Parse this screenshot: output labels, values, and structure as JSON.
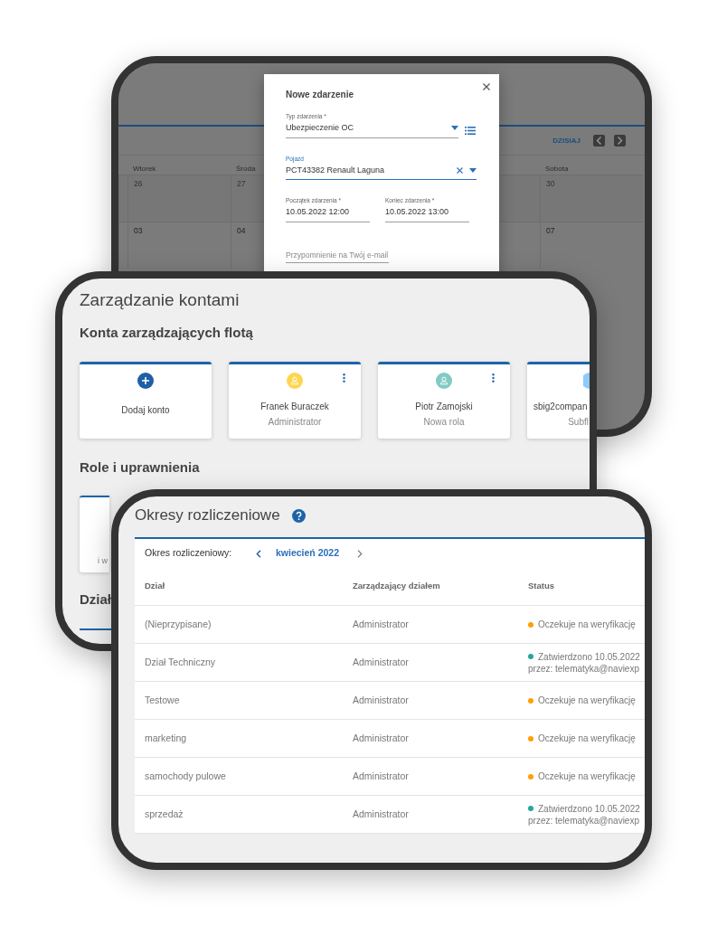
{
  "calendar_window": {
    "today_button": "DZISIAJ",
    "weekdays": [
      "Wtorek",
      "Środa",
      "Sobota"
    ],
    "weeks": [
      [
        "26",
        "27",
        "30"
      ],
      [
        "03",
        "04",
        "07"
      ]
    ],
    "dialog": {
      "title": "Nowe zdarzenie",
      "fields": [
        {
          "kind": "select",
          "label": "Typ zdarzenia *",
          "value": "Ubezpieczenie OC",
          "focused": false
        },
        {
          "kind": "clearable",
          "label": "Pojazd",
          "value": "PCT43382 Renault Laguna",
          "focused": true
        },
        {
          "kind": "text",
          "label": "Początek zdarzenia *",
          "value": "10.05.2022 12:00",
          "focused": false
        },
        {
          "kind": "text",
          "label": "Koniec zdarzenia *",
          "value": "10.05.2022 13:00",
          "focused": false
        },
        {
          "kind": "placeholder",
          "placeholder": "Przypomnienie na Twój e-mail",
          "focused": false
        }
      ]
    }
  },
  "accounts_window": {
    "title": "Zarządzanie kontami",
    "section_title": "Konta zarządzających flotą",
    "cards": [
      {
        "kind": "add",
        "name": "Dodaj konto"
      },
      {
        "kind": "user",
        "name": "Franek Buraczek",
        "role": "Administrator",
        "color": "#ffd54f"
      },
      {
        "kind": "user",
        "name": "Piotr Zamojski",
        "role": "Nowa rola",
        "color": "#80cbc4"
      },
      {
        "kind": "partial",
        "name": "sbig2compan",
        "role": "Subfl",
        "color": "#90caf9"
      }
    ],
    "roles_title": "Role i uprawnienia",
    "role_card_text": "i w",
    "departments_title": "Dział"
  },
  "billing_window": {
    "title": "Okresy rozliczeniowe",
    "period_label": "Okres rozliczeniowy:",
    "period": "kwiecień 2022",
    "columns": [
      "Dział",
      "Zarządzający działem",
      "Status"
    ],
    "rows": [
      {
        "department": "(Nieprzypisane)",
        "manager": "Administrator",
        "status": {
          "color": "#ffa000",
          "text": "Oczekuje na weryfikację"
        }
      },
      {
        "department": "Dział Techniczny",
        "manager": "Administrator",
        "status": {
          "color": "#26a69a",
          "text": "Zatwierdzono 10.05.2022",
          "by": "przez: telematyka@naviexp"
        }
      },
      {
        "department": "Testowe",
        "manager": "Administrator",
        "status": {
          "color": "#ffa000",
          "text": "Oczekuje na weryfikację"
        }
      },
      {
        "department": "marketing",
        "manager": "Administrator",
        "status": {
          "color": "#ffa000",
          "text": "Oczekuje na weryfikację"
        }
      },
      {
        "department": "samochody pulowe",
        "manager": "Administrator",
        "status": {
          "color": "#ffa000",
          "text": "Oczekuje na weryfikację"
        }
      },
      {
        "department": "sprzedaż",
        "manager": "Administrator",
        "status": {
          "color": "#26a69a",
          "text": "Zatwierdzono 10.05.2022",
          "by": "przez: telematyka@naviexp"
        }
      }
    ]
  }
}
